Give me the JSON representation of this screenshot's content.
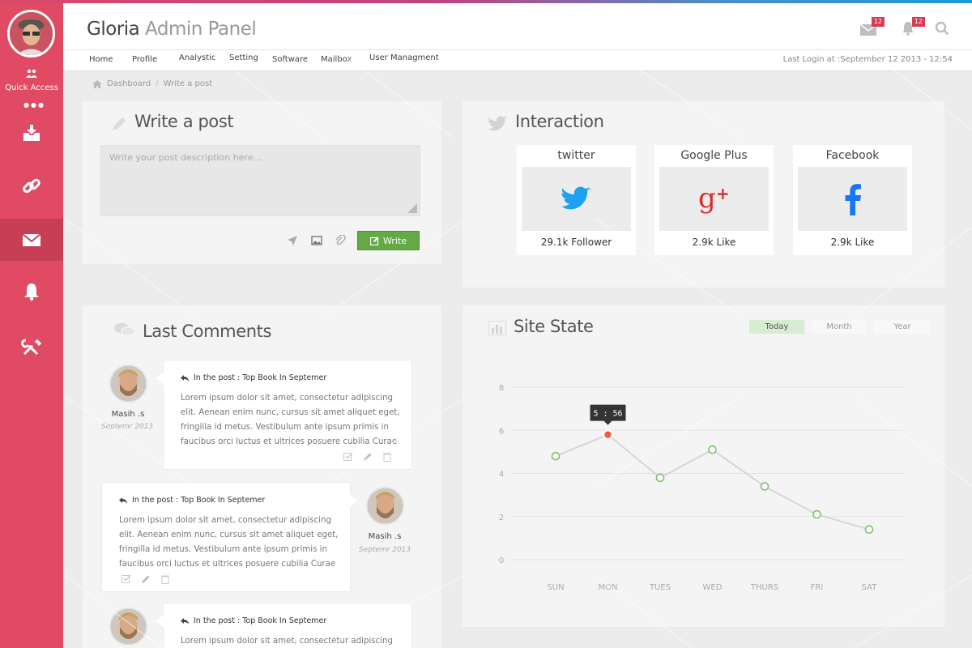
{
  "header": {
    "title_main": "Gloria",
    "title_muted": "Admin Panel",
    "mail_badge": "12",
    "bell_badge": "12"
  },
  "sidebar": {
    "quick_access_label": "Quick Access",
    "items": [
      {
        "icon": "inbox-download-icon"
      },
      {
        "icon": "link-icon"
      },
      {
        "icon": "mail-icon",
        "active": true
      },
      {
        "icon": "bell-icon"
      },
      {
        "icon": "tools-icon"
      }
    ]
  },
  "nav": {
    "items": [
      "Home",
      "Profile",
      "Analystic",
      "Setting",
      "Software",
      "Mailbox",
      "User Managment"
    ],
    "last_login": "Last Login at :September 12 2013 - 12:54"
  },
  "breadcrumb": {
    "items": [
      "Dashboard",
      "Write a post"
    ]
  },
  "write_post": {
    "title": "Write a post",
    "placeholder": "Write your post description here...",
    "button_label": "Write"
  },
  "interaction": {
    "title": "Interaction",
    "cards": [
      {
        "name": "twitter",
        "count": "29.1k Follower",
        "color": "#1da1f2"
      },
      {
        "name": "Google Plus",
        "count": "2.9k Like",
        "color": "#dd2c2c"
      },
      {
        "name": "Facebook",
        "count": "2.9k Like",
        "color": "#1877f2"
      }
    ]
  },
  "comments": {
    "title": "Last Comments",
    "items": [
      {
        "post": "In the post : Top Book In Septemer",
        "text": "Lorem ipsum dolor sit amet, consectetur adipiscing elit. Aenean enim nunc, cursus sit amet aliquet eget, fringilla id metus. Vestibulum ante ipsum primis in faucibus orci luctus et ultrices posuere cubilia Curae",
        "author": "Masih .s",
        "date": "Septemr 2013"
      },
      {
        "post": "In the post : Top Book In Septemer",
        "text": "Lorem ipsum dolor sit amet, consectetur adipiscing elit. Aenean enim nunc, cursus sit amet aliquet eget, fringilla id metus. Vestibulum ante ipsum primis in faucibus orci luctus et ultrices posuere cubilia Curae",
        "author": "Masih .s",
        "date": "Septemr 2013"
      },
      {
        "post": "In the post : Top Book In Septemer",
        "text": "Lorem ipsum dolor sit amet, consectetur adipiscing elit."
      }
    ]
  },
  "site_state": {
    "title": "Site State",
    "tabs": [
      "Today",
      "Month",
      "Year"
    ],
    "active_tab": "Today",
    "tooltip": "5 : 56"
  },
  "chart_data": {
    "type": "line",
    "categories": [
      "SUN",
      "MON",
      "TUES",
      "WED",
      "THURS",
      "FRI",
      "SAT"
    ],
    "values": [
      4.8,
      5.8,
      3.8,
      5.1,
      3.4,
      2.1,
      1.4
    ],
    "highlight_index": 1,
    "yticks": [
      "0",
      "2",
      "4",
      "6",
      "8"
    ],
    "ylim": [
      0,
      8
    ],
    "grid": true,
    "line_color": "#d6d6d6",
    "point_color": "#7cc06a",
    "highlight_color": "#f05a3c"
  }
}
